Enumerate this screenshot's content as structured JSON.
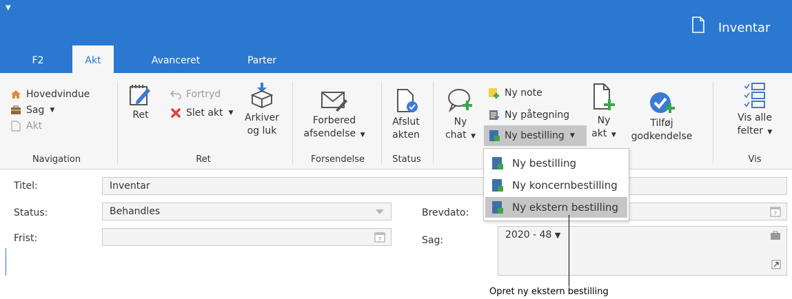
{
  "window": {
    "qat_glyph": "▼",
    "title": "Inventar"
  },
  "tabs": [
    {
      "label": "F2"
    },
    {
      "label": "Akt"
    },
    {
      "label": "Avanceret"
    },
    {
      "label": "Parter"
    }
  ],
  "ribbon": {
    "navigation": {
      "label": "Navigation",
      "hovedvindue": "Hovedvindue",
      "sag": "Sag",
      "akt": "Akt"
    },
    "ret": {
      "label": "Ret",
      "ret": "Ret",
      "fortryd": "Fortryd",
      "slet_akt": "Slet akt"
    },
    "arkiver": {
      "line1": "Arkiver",
      "line2": "og luk"
    },
    "forsendelse": {
      "label": "Forsendelse",
      "line1": "Forbered",
      "line2": "afsendelse"
    },
    "status": {
      "label": "Status",
      "line1": "Afslut",
      "line2": "akten"
    },
    "ny_chat": {
      "line1": "Ny",
      "line2": "chat"
    },
    "ny_note": "Ny note",
    "ny_paategning": "Ny påtegning",
    "ny_bestilling": "Ny bestilling",
    "ny_akt": {
      "line1": "Ny",
      "line2": "akt"
    },
    "tilfoej": {
      "line1": "Tilføj",
      "line2": "godkendelse"
    },
    "vis": {
      "label": "Vis",
      "line1": "Vis alle",
      "line2": "felter"
    }
  },
  "dropdown": {
    "items": [
      "Ny bestilling",
      "Ny koncernbestilling",
      "Ny ekstern bestilling"
    ]
  },
  "form": {
    "titel_label": "Titel:",
    "titel_value": "Inventar",
    "status_label": "Status:",
    "status_value": "Behandles",
    "frist_label": "Frist:",
    "frist_value": "",
    "brevdato_label": "Brevdato:",
    "sag_label": "Sag:",
    "sag_value": "2020 - 48"
  },
  "callout": "Opret ny ekstern bestilling",
  "colors": {
    "accent": "#2b78d0",
    "highlight": "#c6c6c6",
    "delete_red": "#e0403a",
    "green": "#3aa64a"
  }
}
